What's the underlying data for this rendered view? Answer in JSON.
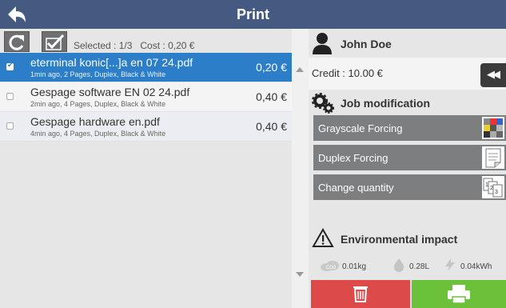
{
  "header": {
    "title": "Print"
  },
  "toolbar": {
    "selected_text": "Selected : 1/3",
    "cost_text": "Cost : 0,20 €"
  },
  "jobs": [
    {
      "name": "eterminal konic[...]a en 07 24.pdf",
      "meta": "1min ago, 2 Pages, Duplex, Black & White",
      "cost": "0,20 €",
      "selected": true
    },
    {
      "name": "Gespage software EN 02 24.pdf",
      "meta": "2min ago, 4 Pages, Duplex, Black & White",
      "cost": "0,40 €",
      "selected": false
    },
    {
      "name": "Gespage hardware en.pdf",
      "meta": "4min ago, 4 Pages, Duplex, Black & White",
      "cost": "0,40 €",
      "selected": false
    }
  ],
  "user": {
    "name": "John Doe",
    "credit": "Credit : 10.00 €"
  },
  "job_modification": {
    "title": "Job modification",
    "buttons": [
      "Grayscale Forcing",
      "Duplex Forcing",
      "Change quantity"
    ]
  },
  "environment": {
    "title": "Environmental impact",
    "co2": "0.01kg",
    "water": "0.28L",
    "energy": "0.04kWh"
  },
  "colors": {
    "header": "#455a80",
    "selected_row": "#2c7ec8",
    "delete": "#dd4a4a",
    "print": "#6cc13a",
    "mod_button": "#7d7e80"
  }
}
